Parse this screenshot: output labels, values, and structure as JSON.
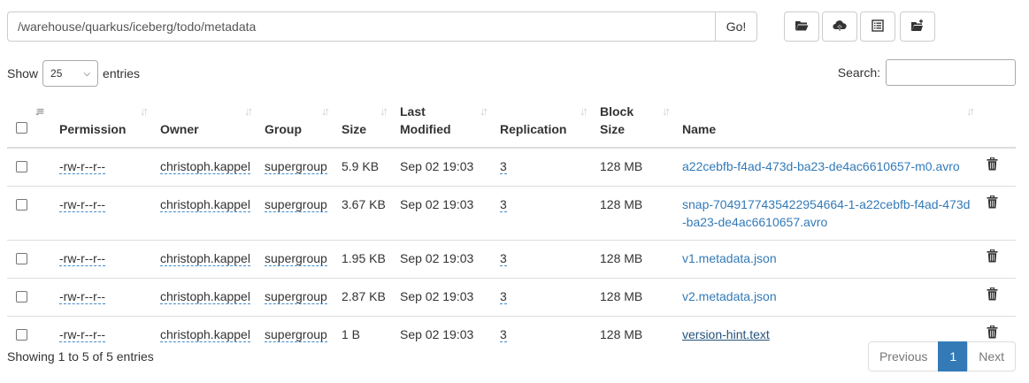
{
  "path_bar": {
    "value": "/warehouse/quarkus/iceberg/todo/metadata",
    "go_label": "Go!"
  },
  "toolbar": [
    {
      "icon": "folder-open-icon"
    },
    {
      "icon": "cloud-upload-icon"
    },
    {
      "icon": "list-icon"
    },
    {
      "icon": "folder-add-icon"
    }
  ],
  "length": {
    "show_label": "Show",
    "value": "25",
    "entries_label": "entries"
  },
  "search": {
    "label": "Search:",
    "value": ""
  },
  "table": {
    "headers": {
      "permission": "Permission",
      "owner": "Owner",
      "group": "Group",
      "size": "Size",
      "last_modified_1": "Last",
      "last_modified_2": "Modified",
      "replication": "Replication",
      "block_size_1": "Block",
      "block_size_2": "Size",
      "name": "Name"
    },
    "rows": [
      {
        "permission": "-rw-r--r--",
        "owner": "christoph.kappel",
        "group": "supergroup",
        "size": "5.9 KB",
        "modified": "Sep 02 19:03",
        "replication": "3",
        "block_size": "128 MB",
        "name": "a22cebfb-f4ad-473d-ba23-de4ac6610657-m0.avro"
      },
      {
        "permission": "-rw-r--r--",
        "owner": "christoph.kappel",
        "group": "supergroup",
        "size": "3.67 KB",
        "modified": "Sep 02 19:03",
        "replication": "3",
        "block_size": "128 MB",
        "name": "snap-7049177435422954664-1-a22cebfb-f4ad-473d-ba23-de4ac6610657.avro"
      },
      {
        "permission": "-rw-r--r--",
        "owner": "christoph.kappel",
        "group": "supergroup",
        "size": "1.95 KB",
        "modified": "Sep 02 19:03",
        "replication": "3",
        "block_size": "128 MB",
        "name": "v1.metadata.json"
      },
      {
        "permission": "-rw-r--r--",
        "owner": "christoph.kappel",
        "group": "supergroup",
        "size": "2.87 KB",
        "modified": "Sep 02 19:03",
        "replication": "3",
        "block_size": "128 MB",
        "name": "v2.metadata.json"
      },
      {
        "permission": "-rw-r--r--",
        "owner": "christoph.kappel",
        "group": "supergroup",
        "size": "1 B",
        "modified": "Sep 02 19:03",
        "replication": "3",
        "block_size": "128 MB",
        "name": "version-hint.text"
      }
    ]
  },
  "footer": {
    "info": "Showing 1 to 5 of 5 entries",
    "previous": "Previous",
    "current_page": "1",
    "next": "Next"
  },
  "colors": {
    "link": "#337ab7",
    "active_page": "#337ab7",
    "border": "#dddddd"
  }
}
